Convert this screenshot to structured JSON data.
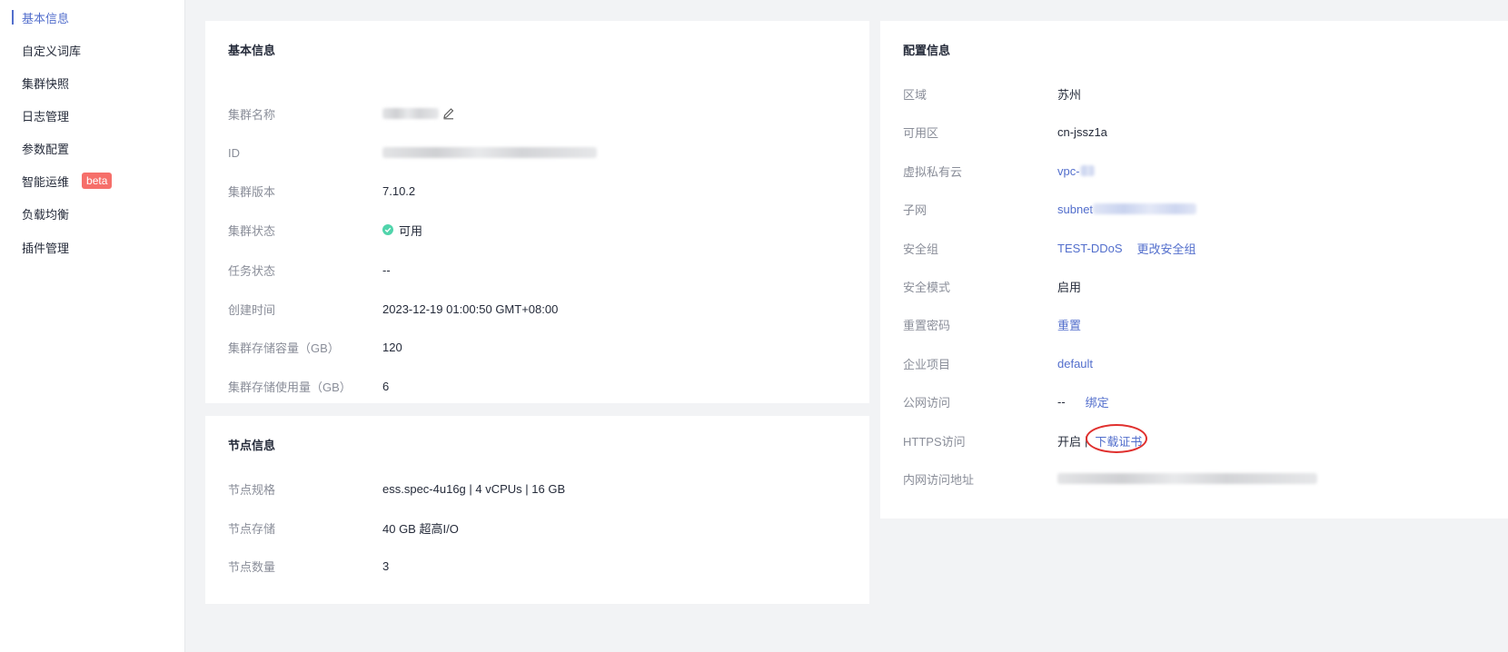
{
  "sidebar": {
    "items": [
      {
        "label": "基本信息",
        "active": true
      },
      {
        "label": "自定义词库"
      },
      {
        "label": "集群快照"
      },
      {
        "label": "日志管理"
      },
      {
        "label": "参数配置"
      },
      {
        "label": "智能运维",
        "badge": "beta"
      },
      {
        "label": "负载均衡"
      },
      {
        "label": "插件管理"
      }
    ]
  },
  "basic": {
    "title": "基本信息",
    "cluster_name_label": "集群名称",
    "id_label": "ID",
    "version_label": "集群版本",
    "version": "7.10.2",
    "status_label": "集群状态",
    "status": "可用",
    "task_label": "任务状态",
    "task": "--",
    "created_label": "创建时间",
    "created": "2023-12-19 01:00:50 GMT+08:00",
    "capacity_label": "集群存储容量（GB）",
    "capacity": "120",
    "used_label": "集群存储使用量（GB）",
    "used": "6"
  },
  "node": {
    "title": "节点信息",
    "spec_label": "节点规格",
    "spec": "ess.spec-4u16g | 4 vCPUs | 16 GB",
    "storage_label": "节点存储",
    "storage": "40 GB 超高I/O",
    "count_label": "节点数量",
    "count": "3"
  },
  "config": {
    "title": "配置信息",
    "region_label": "区域",
    "region": "苏州",
    "az_label": "可用区",
    "az": "cn-jssz1a",
    "vpc_label": "虚拟私有云",
    "vpc_prefix": "vpc-",
    "subnet_label": "子网",
    "subnet_prefix": "subnet",
    "sg_label": "安全组",
    "sg": "TEST-DDoS",
    "sg_change": "更改安全组",
    "security_mode_label": "安全模式",
    "security_mode": "启用",
    "reset_pwd_label": "重置密码",
    "reset_pwd": "重置",
    "project_label": "企业项目",
    "project": "default",
    "public_label": "公网访问",
    "public": "--",
    "bind": "绑定",
    "https_label": "HTTPS访问",
    "https": "开启",
    "https_sep": "|",
    "download_cert": "下载证书",
    "intranet_label": "内网访问地址"
  },
  "colors": {
    "link": "#526ecc",
    "success": "#50d4ab",
    "badge": "#f66f6a",
    "highlight_ring": "#e0302e"
  }
}
